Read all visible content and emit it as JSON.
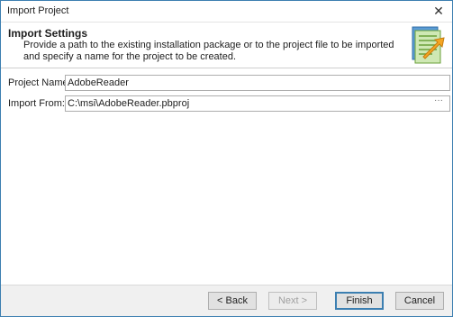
{
  "window": {
    "title": "Import Project",
    "close_glyph": "✕"
  },
  "header": {
    "title": "Import Settings",
    "description": "Provide a path to the existing installation package or to the project file to be imported and specify a name for the project to be created.",
    "icon": "import-wizard-icon"
  },
  "form": {
    "project_name": {
      "label": "Project Name:",
      "value": "AdobeReader"
    },
    "import_from": {
      "label": "Import From:",
      "value": "C:\\msi\\AdobeReader.pbproj",
      "browse_glyph": "···"
    }
  },
  "footer": {
    "back_label": "< Back",
    "next_label": "Next >",
    "finish_label": "Finish",
    "cancel_label": "Cancel"
  },
  "colors": {
    "accent": "#3c7fb1",
    "dialog_bg": "#f0f0f0"
  }
}
